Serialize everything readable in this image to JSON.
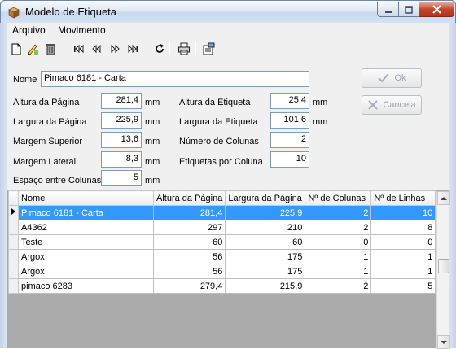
{
  "window": {
    "title": "Modelo de Etiqueta"
  },
  "menu": {
    "items": [
      "Arquivo",
      "Movimento"
    ]
  },
  "toolbar": {
    "icons": [
      "new-document-icon",
      "edit-pencil-icon",
      "delete-trash-icon",
      "first-record-icon",
      "previous-record-icon",
      "next-record-icon",
      "last-record-icon",
      "refresh-icon",
      "print-icon",
      "properties-icon"
    ]
  },
  "form": {
    "nome_label": "Nome",
    "nome_value": "Pimaco 6181 - Carta",
    "altura_pagina_label": "Altura da Página",
    "altura_pagina_value": "281,4",
    "largura_pagina_label": "Largura da Página",
    "largura_pagina_value": "225,9",
    "margem_superior_label": "Margem Superior",
    "margem_superior_value": "13,6",
    "margem_lateral_label": "Margem Lateral",
    "margem_lateral_value": "8,3",
    "espaco_colunas_label": "Espaço entre Colunas",
    "espaco_colunas_value": "5",
    "altura_etiqueta_label": "Altura da Etiqueta",
    "altura_etiqueta_value": "25,4",
    "largura_etiqueta_label": "Largura da Etiqueta",
    "largura_etiqueta_value": "101,6",
    "num_colunas_label": "Número de Colunas",
    "num_colunas_value": "2",
    "etiquetas_coluna_label": "Etiquetas por Coluna",
    "etiquetas_coluna_value": "10",
    "unit": "mm",
    "ok_label": "Ok",
    "cancela_label": "Cancela"
  },
  "grid": {
    "columns": [
      "Nome",
      "Altura da Página",
      "Largura da Página",
      "Nº de Colunas",
      "Nº de Linhas"
    ],
    "rows": [
      {
        "nome": "Pimaco 6181 - Carta",
        "altura": "281,4",
        "largura": "225,9",
        "colunas": "2",
        "linhas": "10",
        "selected": true
      },
      {
        "nome": "A4362",
        "altura": "297",
        "largura": "210",
        "colunas": "2",
        "linhas": "8"
      },
      {
        "nome": "Teste",
        "altura": "60",
        "largura": "60",
        "colunas": "0",
        "linhas": "0"
      },
      {
        "nome": "Argox",
        "altura": "56",
        "largura": "175",
        "colunas": "1",
        "linhas": "1"
      },
      {
        "nome": "Argox",
        "altura": "56",
        "largura": "175",
        "colunas": "1",
        "linhas": "1"
      },
      {
        "nome": "pimaco 6283",
        "altura": "279,4",
        "largura": "215,9",
        "colunas": "2",
        "linhas": "5"
      }
    ]
  },
  "colors": {
    "selection": "#3399ff",
    "titlebar": "#dfe8f5"
  }
}
